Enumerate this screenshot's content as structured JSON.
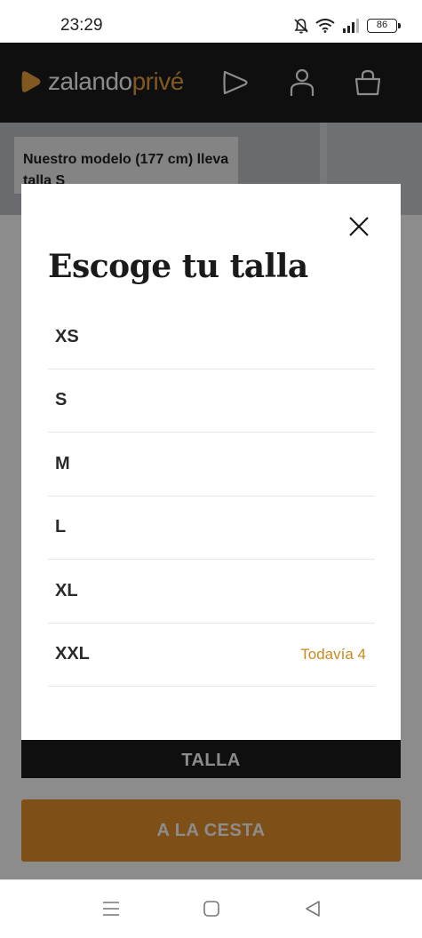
{
  "status_bar": {
    "time": "23:29",
    "battery": "86",
    "icons": [
      "bell-off-icon",
      "wifi-icon",
      "signal-icon",
      "battery-icon"
    ]
  },
  "header": {
    "logo_main": "zalando",
    "logo_accent": "privé",
    "icons": [
      "play-icon",
      "user-icon",
      "bag-icon"
    ]
  },
  "background_page": {
    "model_label": "Nuestro modelo (177 cm) lleva talla S",
    "talla_button": "TALLA",
    "cart_button": "A LA CESTA"
  },
  "modal": {
    "title": "Escoge tu talla",
    "sizes": [
      {
        "label": "XS",
        "note": ""
      },
      {
        "label": "S",
        "note": ""
      },
      {
        "label": "M",
        "note": ""
      },
      {
        "label": "L",
        "note": ""
      },
      {
        "label": "XL",
        "note": ""
      },
      {
        "label": "XXL",
        "note": "Todavía 4"
      }
    ]
  },
  "colors": {
    "header_bg": "#1c1c1c",
    "accent": "#e8a33c",
    "cart_button": "#e8902c",
    "stock_note": "#c98a1e"
  }
}
